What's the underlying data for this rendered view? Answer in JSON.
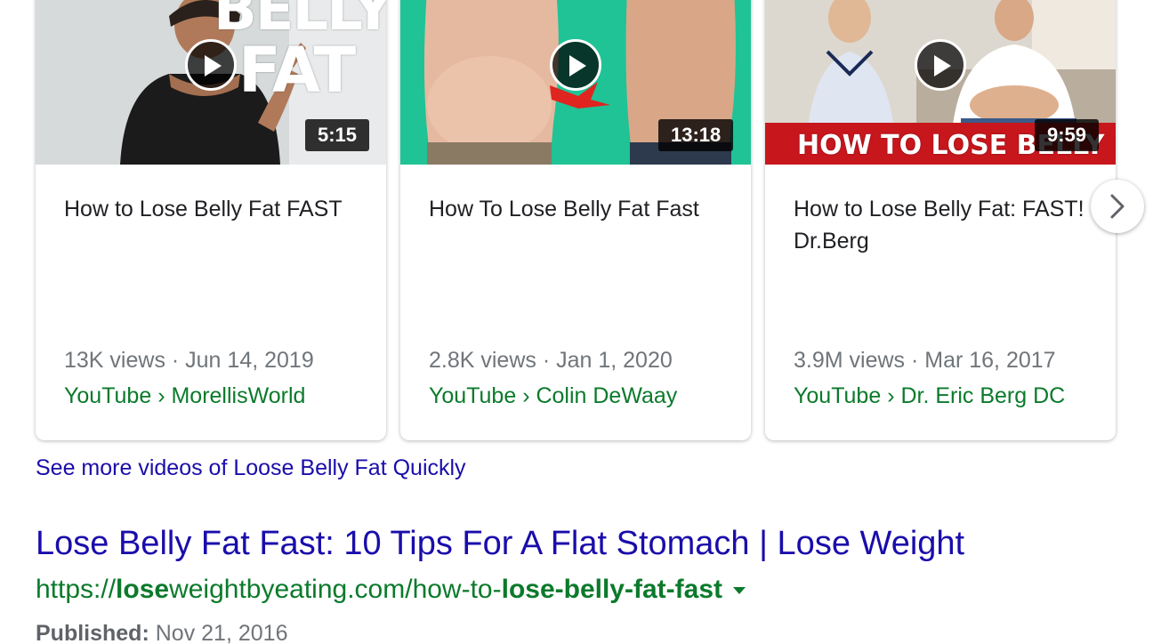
{
  "videos": [
    {
      "thumb_text": "BELLY FAT",
      "thumb_text_lines": [
        "BELLY",
        "FAT"
      ],
      "duration": "5:15",
      "title": "How to Lose Belly Fat FAST",
      "meta": "13K views · Jun 14, 2019",
      "source": "YouTube › MorellisWorld"
    },
    {
      "duration": "13:18",
      "title": "How To Lose Belly Fat Fast",
      "meta": "2.8K views · Jan 1, 2020",
      "source": "YouTube › Colin DeWaay"
    },
    {
      "thumb_text": "HOW TO LOSE BELLY FAT",
      "duration": "9:59",
      "title": "How to Lose Belly Fat: FAST! Dr.Berg",
      "meta": "3.9M views · Mar 16, 2017",
      "source": "YouTube › Dr. Eric Berg DC"
    }
  ],
  "see_more": "See more videos of Loose Belly Fat Quickly",
  "result": {
    "title": "Lose Belly Fat Fast: 10 Tips For A Flat Stomach | Lose Weight",
    "url_parts": {
      "prefix": "https://",
      "bold1": "lose",
      "mid": "weightbyeating.com/how-to-",
      "bold2": "lose-belly-fat-fast"
    },
    "published_label": "Published:",
    "published_date": "Nov 21, 2016"
  },
  "icons": {
    "play": "play-icon",
    "next": "chevron-right-icon",
    "caret": "caret-down-icon"
  },
  "colors": {
    "link": "#1a0dab",
    "url_green": "#0b7a2b",
    "meta_gray": "#70757a",
    "title_text": "#202124",
    "thumb2_bg": "#1fc396",
    "banner_red": "#c8161d"
  }
}
